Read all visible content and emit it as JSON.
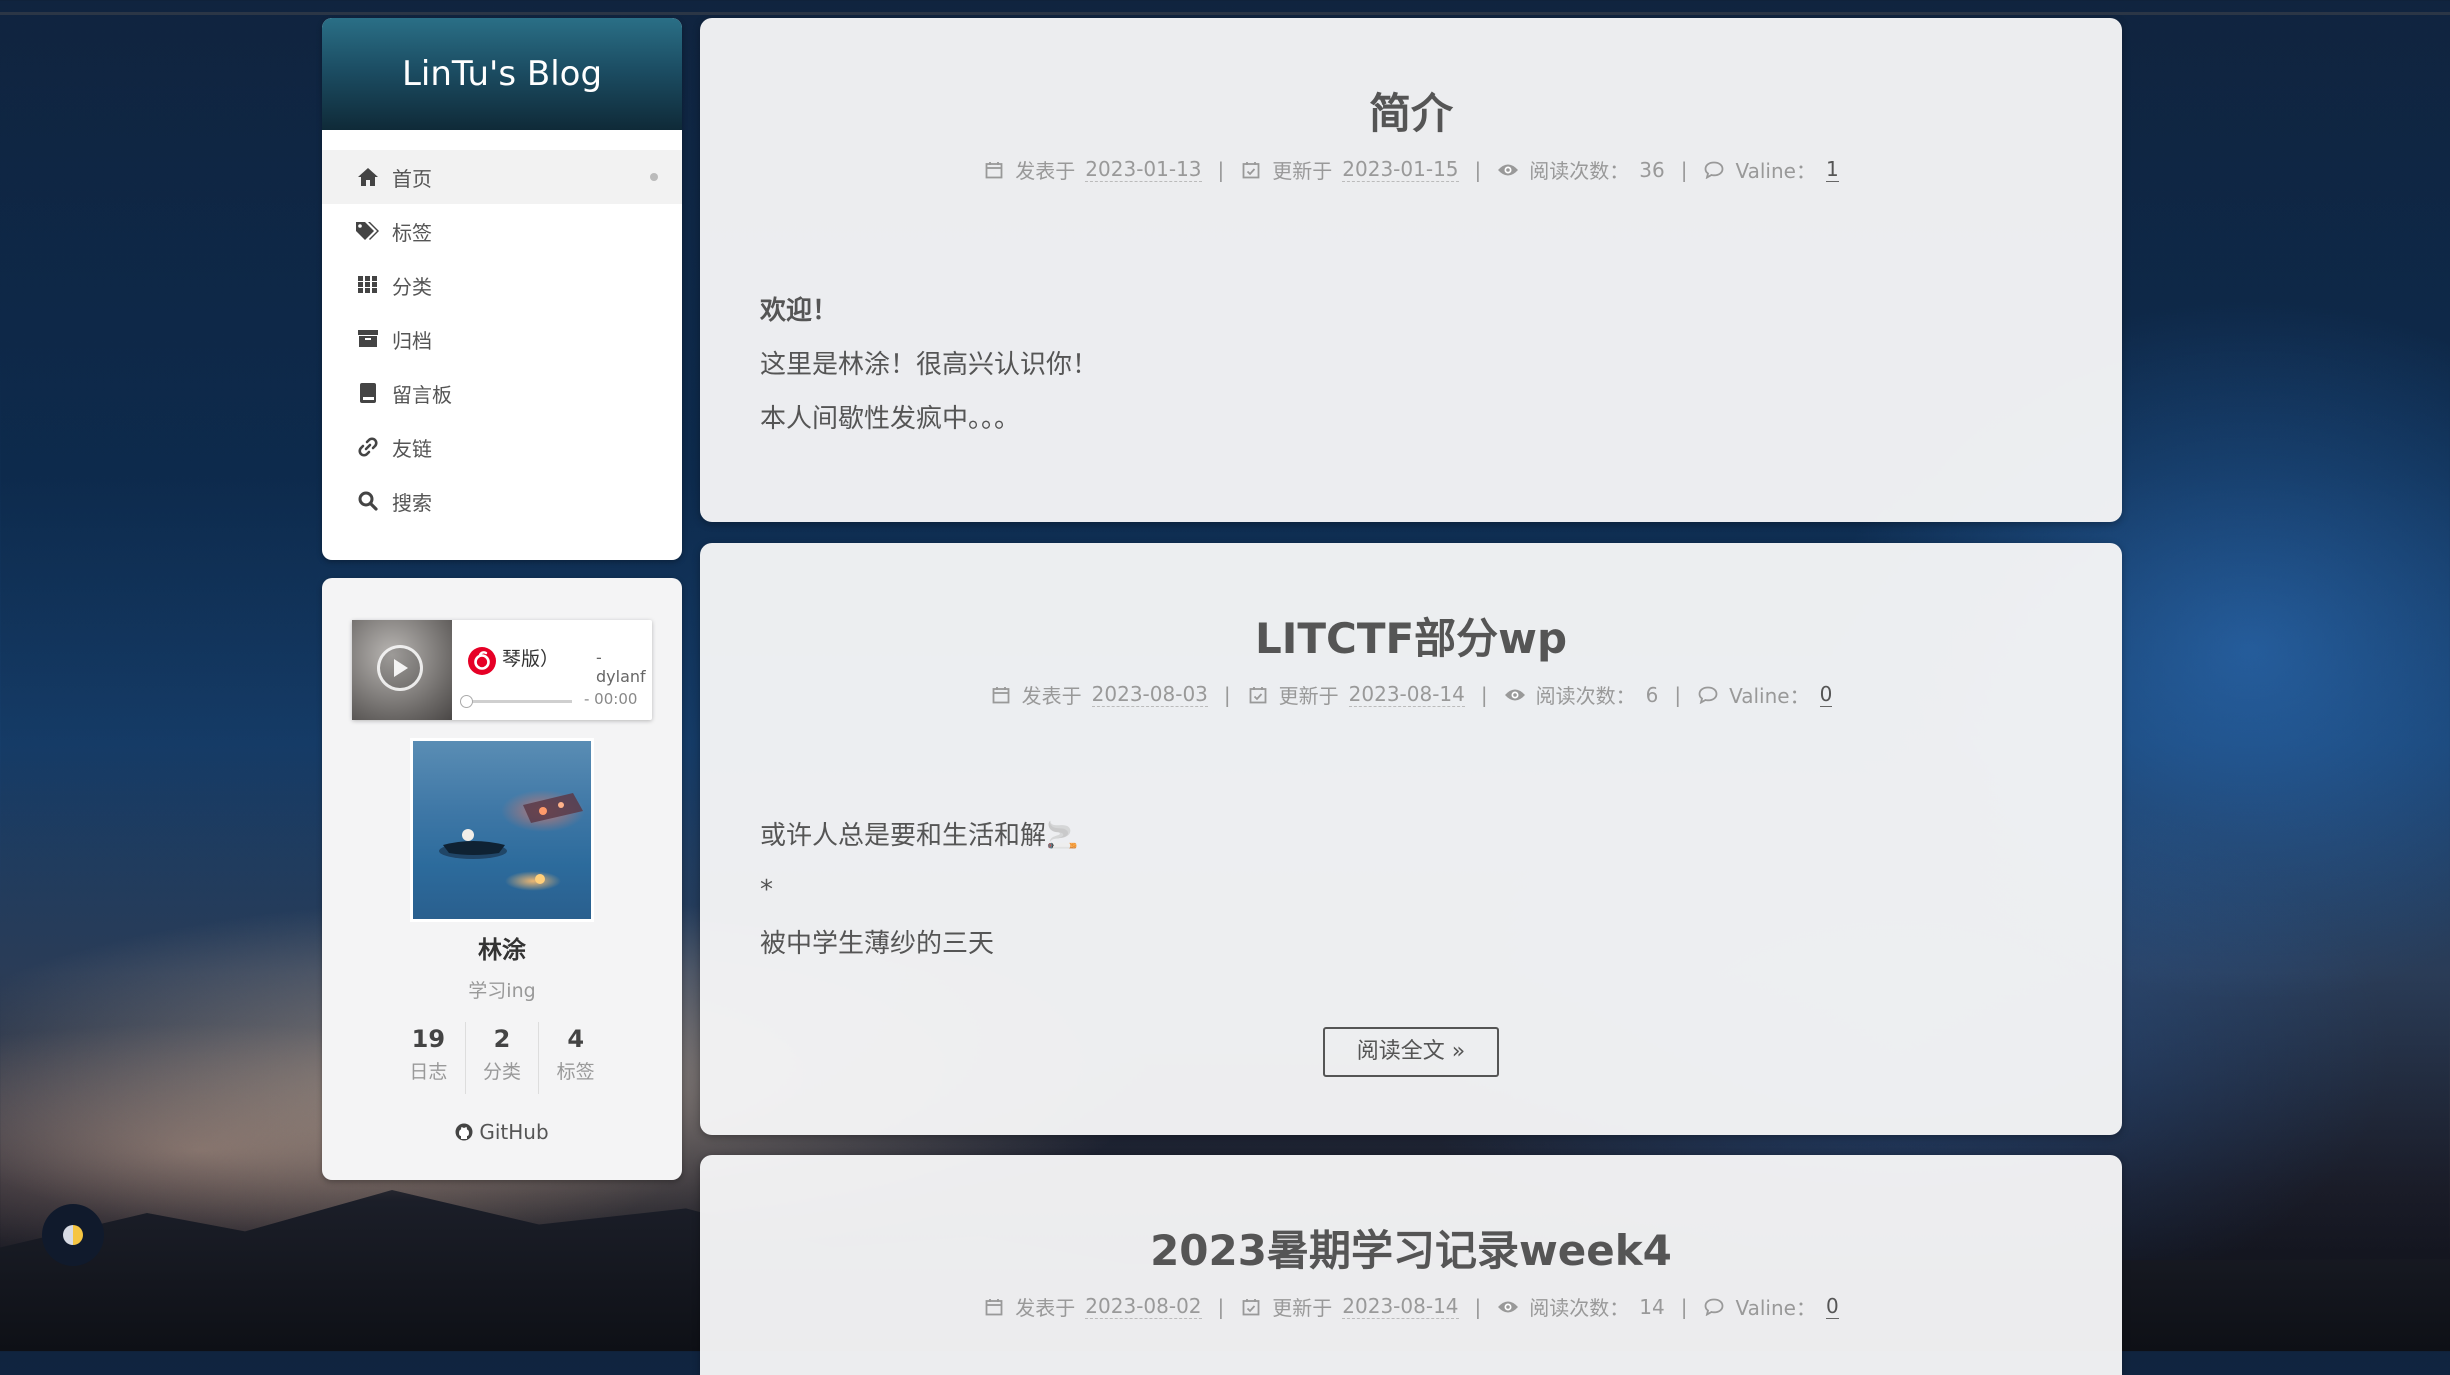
{
  "site": {
    "title": "LinTu's Blog"
  },
  "menu": [
    {
      "label": "首页",
      "icon": "home-icon",
      "active": true
    },
    {
      "label": "标签",
      "icon": "tags-icon",
      "active": false
    },
    {
      "label": "分类",
      "icon": "grid-icon",
      "active": false
    },
    {
      "label": "归档",
      "icon": "archive-icon",
      "active": false
    },
    {
      "label": "留言板",
      "icon": "book-icon",
      "active": false
    },
    {
      "label": "友链",
      "icon": "link-icon",
      "active": false
    },
    {
      "label": "搜索",
      "icon": "search-icon",
      "active": false
    }
  ],
  "player": {
    "title": "琴版）",
    "author": "- dylanf",
    "time": "- 00:00",
    "progress": 0
  },
  "author": {
    "name": "林涂",
    "description": "学习ing",
    "stats": [
      {
        "count": "19",
        "label": "日志"
      },
      {
        "count": "2",
        "label": "分类"
      },
      {
        "count": "4",
        "label": "标签"
      }
    ],
    "github_label": "GitHub"
  },
  "meta_labels": {
    "posted": "发表于",
    "updated": "更新于",
    "views": "阅读次数：",
    "comments": "Valine："
  },
  "posts": [
    {
      "title": "简介",
      "posted": "2023-01-13",
      "updated": "2023-01-15",
      "views": "36",
      "comments": "1",
      "lines": [
        "欢迎！",
        "这里是林涂！很高兴认识你！",
        "本人间歇性发疯中。。。"
      ]
    },
    {
      "title": "LITCTF部分wp",
      "posted": "2023-08-03",
      "updated": "2023-08-14",
      "views": "6",
      "comments": "0",
      "lines": [
        "或许人总是要和生活和解🚬",
        "*",
        "被中学生薄纱的三天"
      ],
      "readmore": "阅读全文 »"
    },
    {
      "title": "2023暑期学习记录week4",
      "posted": "2023-08-02",
      "updated": "2023-08-14",
      "views": "14",
      "comments": "0"
    }
  ],
  "colors": {
    "accent": "#1c4e64",
    "text": "#555555",
    "muted": "#999999",
    "netease_red": "#e60026"
  }
}
